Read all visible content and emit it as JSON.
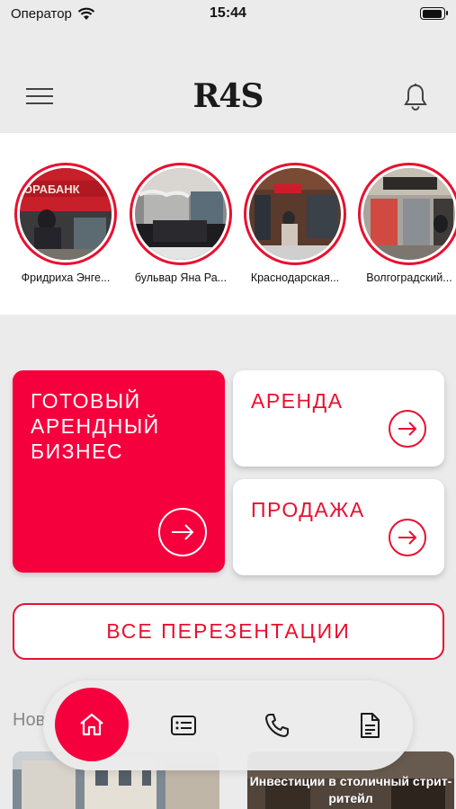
{
  "status_bar": {
    "carrier": "Оператор",
    "time": "15:44"
  },
  "header": {
    "logo": "R4S"
  },
  "stories": [
    {
      "label": "Фридриха Энге..."
    },
    {
      "label": "бульвар Яна Ра..."
    },
    {
      "label": "Краснодарская..."
    },
    {
      "label": "Волгоградский..."
    }
  ],
  "cards": {
    "ready_business": "ГОТОВЫЙ АРЕНДНЫЙ БИЗНЕС",
    "rent": "АРЕНДА",
    "sale": "ПРОДАЖА"
  },
  "all_presentations": "ВСЕ ПЕРЕЗЕНТАЦИИ",
  "news": {
    "title": "Нов",
    "items": [
      {
        "caption": ""
      },
      {
        "caption": "Инвестиции в столичный стрит-ритейл"
      }
    ]
  },
  "colors": {
    "accent": "#f5003d",
    "accent_text": "#e8102f",
    "background": "#ebebeb"
  },
  "bottom_nav": [
    "home-icon",
    "id-card-icon",
    "phone-icon",
    "document-icon"
  ]
}
